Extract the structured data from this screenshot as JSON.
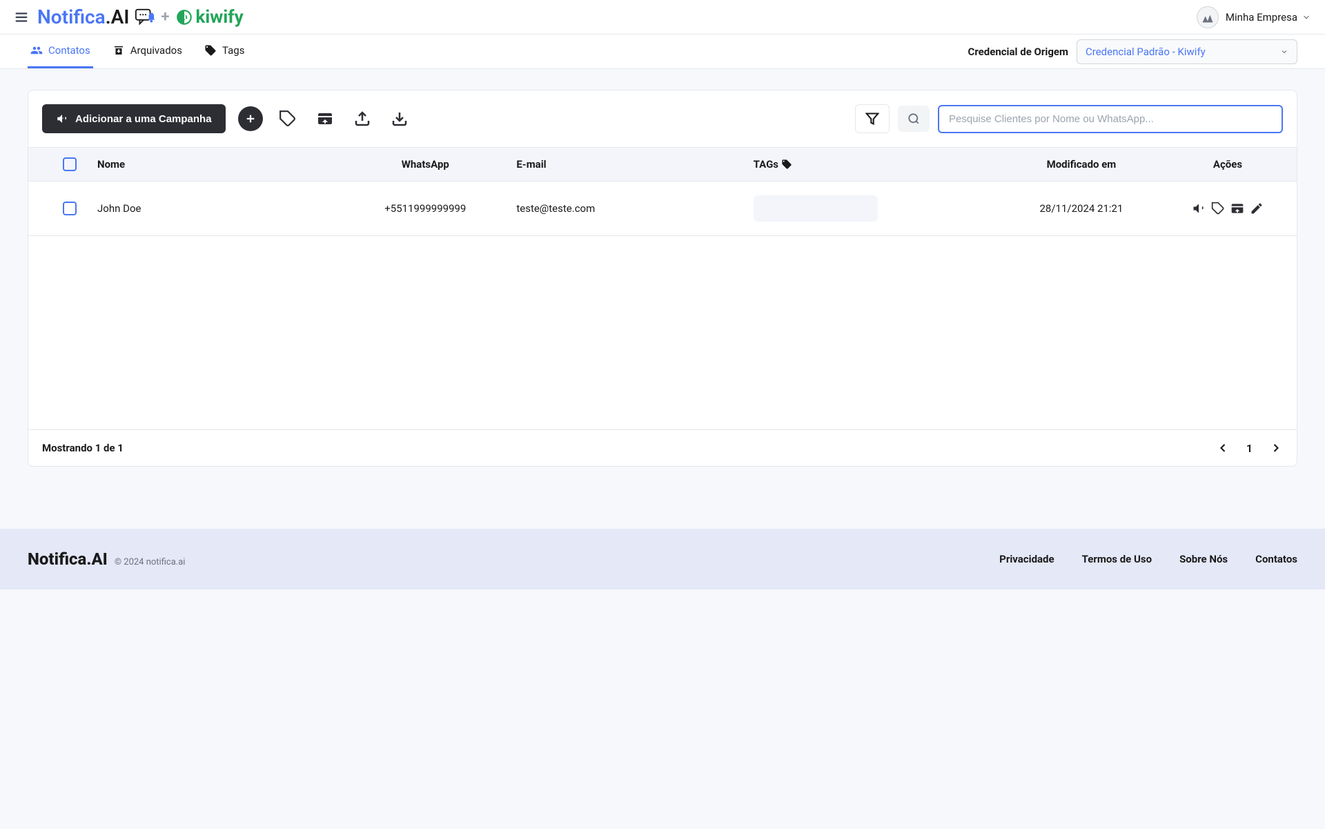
{
  "header": {
    "logo_part1": "Notifica",
    "logo_part2": ".AI",
    "plus": "+",
    "kiwify": "kiwify",
    "company": "Minha Empresa"
  },
  "nav": {
    "tabs": [
      {
        "label": "Contatos",
        "active": true
      },
      {
        "label": "Arquivados",
        "active": false
      },
      {
        "label": "Tags",
        "active": false
      }
    ],
    "credential_label": "Credencial de Origem",
    "credential_value": "Credencial Padrão - Kiwify"
  },
  "toolbar": {
    "campaign_btn": "Adicionar a uma Campanha",
    "search_placeholder": "Pesquise Clientes por Nome ou WhatsApp..."
  },
  "table": {
    "headers": {
      "name": "Nome",
      "whatsapp": "WhatsApp",
      "email": "E-mail",
      "tags": "TAGs",
      "modified": "Modificado em",
      "actions": "Ações"
    },
    "rows": [
      {
        "name": "John Doe",
        "whatsapp": "+5511999999999",
        "email": "teste@teste.com",
        "tags": "",
        "modified": "28/11/2024 21:21"
      }
    ],
    "showing": "Mostrando 1 de 1",
    "page": "1"
  },
  "footer": {
    "logo": "Notifica.AI",
    "copyright": "© 2024 notifica.ai",
    "links": [
      "Privacidade",
      "Termos de Uso",
      "Sobre Nós",
      "Contatos"
    ]
  }
}
